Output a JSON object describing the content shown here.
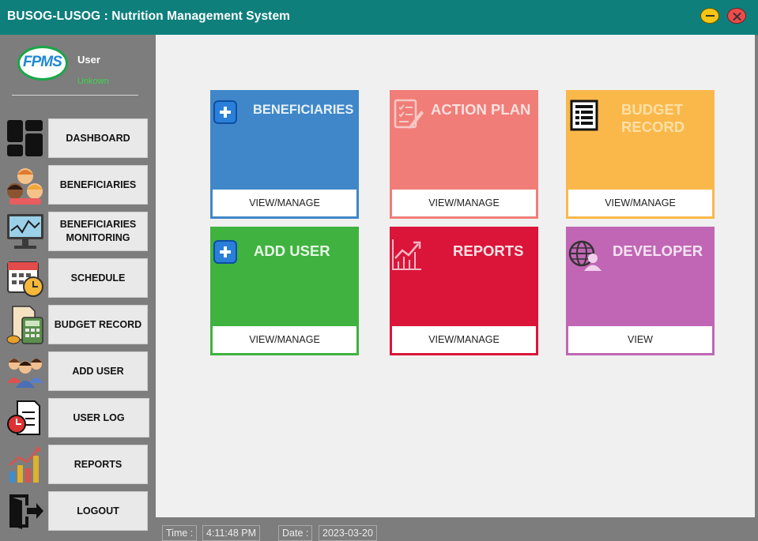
{
  "window": {
    "title": "BUSOG-LUSOG : Nutrition Management System"
  },
  "sidebar": {
    "logo_text": "FPMS",
    "user_name": "User",
    "user_status": "Unkown",
    "items": [
      {
        "label": "DASHBOARD",
        "icon": "dashboard-icon"
      },
      {
        "label": "BENEFICIARIES",
        "icon": "children-icon"
      },
      {
        "label": "BENEFICIARIES MONITORING",
        "icon": "monitor-icon"
      },
      {
        "label": "SCHEDULE",
        "icon": "calendar-clock-icon"
      },
      {
        "label": "BUDGET RECORD",
        "icon": "calculator-icon"
      },
      {
        "label": "ADD USER",
        "icon": "users-icon"
      },
      {
        "label": "USER LOG",
        "icon": "log-icon"
      },
      {
        "label": "REPORTS",
        "icon": "bar-chart-icon"
      },
      {
        "label": "LOGOUT",
        "icon": "logout-icon"
      }
    ]
  },
  "tiles": [
    {
      "title": "BENEFICIARIES",
      "button": "VIEW/MANAGE",
      "color": "#3f87c8",
      "icon": "plus-icon"
    },
    {
      "title": "ACTION PLAN",
      "button": "VIEW/MANAGE",
      "color": "#f17d78",
      "icon": "checklist-icon"
    },
    {
      "title": "BUDGET RECORD",
      "button": "VIEW/MANAGE",
      "color": "#fbb84a",
      "icon": "document-icon"
    },
    {
      "title": "ADD USER",
      "button": "VIEW/MANAGE",
      "color": "#3fb23f",
      "icon": "plus-icon"
    },
    {
      "title": "REPORTS",
      "button": "VIEW/MANAGE",
      "color": "#da1539",
      "icon": "growth-chart-icon"
    },
    {
      "title": "DEVELOPER",
      "button": "VIEW",
      "color": "#c166b5",
      "icon": "globe-user-icon"
    }
  ],
  "status": {
    "time_label": "Time :",
    "time_value": "4:11:48 PM",
    "date_label": "Date :",
    "date_value": "2023-03-20"
  }
}
